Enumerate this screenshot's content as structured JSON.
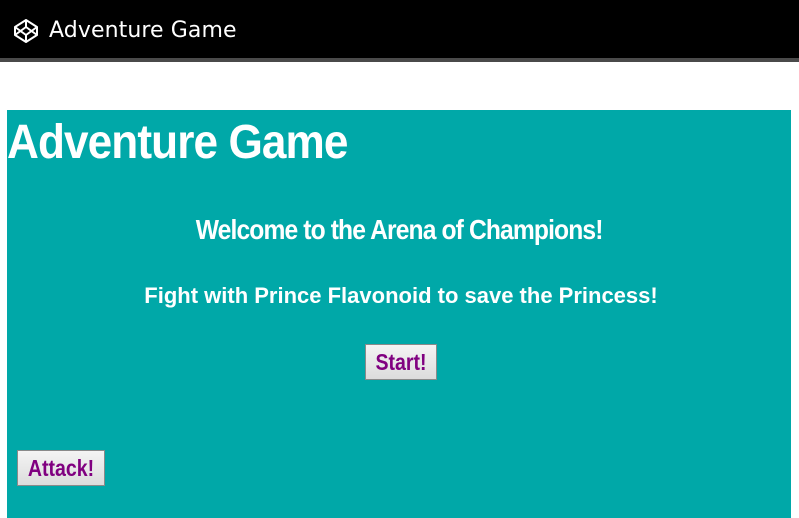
{
  "header": {
    "title": "Adventure Game",
    "logo_icon": "codepen-logo-icon"
  },
  "game": {
    "title": "Adventure Game",
    "welcome": "Welcome to the Arena of Champions!",
    "subtitle": "Fight with Prince Flavonoid to save the Princess!",
    "start_label": "Start!",
    "attack_label": "Attack!"
  },
  "colors": {
    "header_bg": "#000000",
    "stage_bg": "#00a8a8",
    "text": "#ffffff",
    "button_text": "#800080"
  }
}
